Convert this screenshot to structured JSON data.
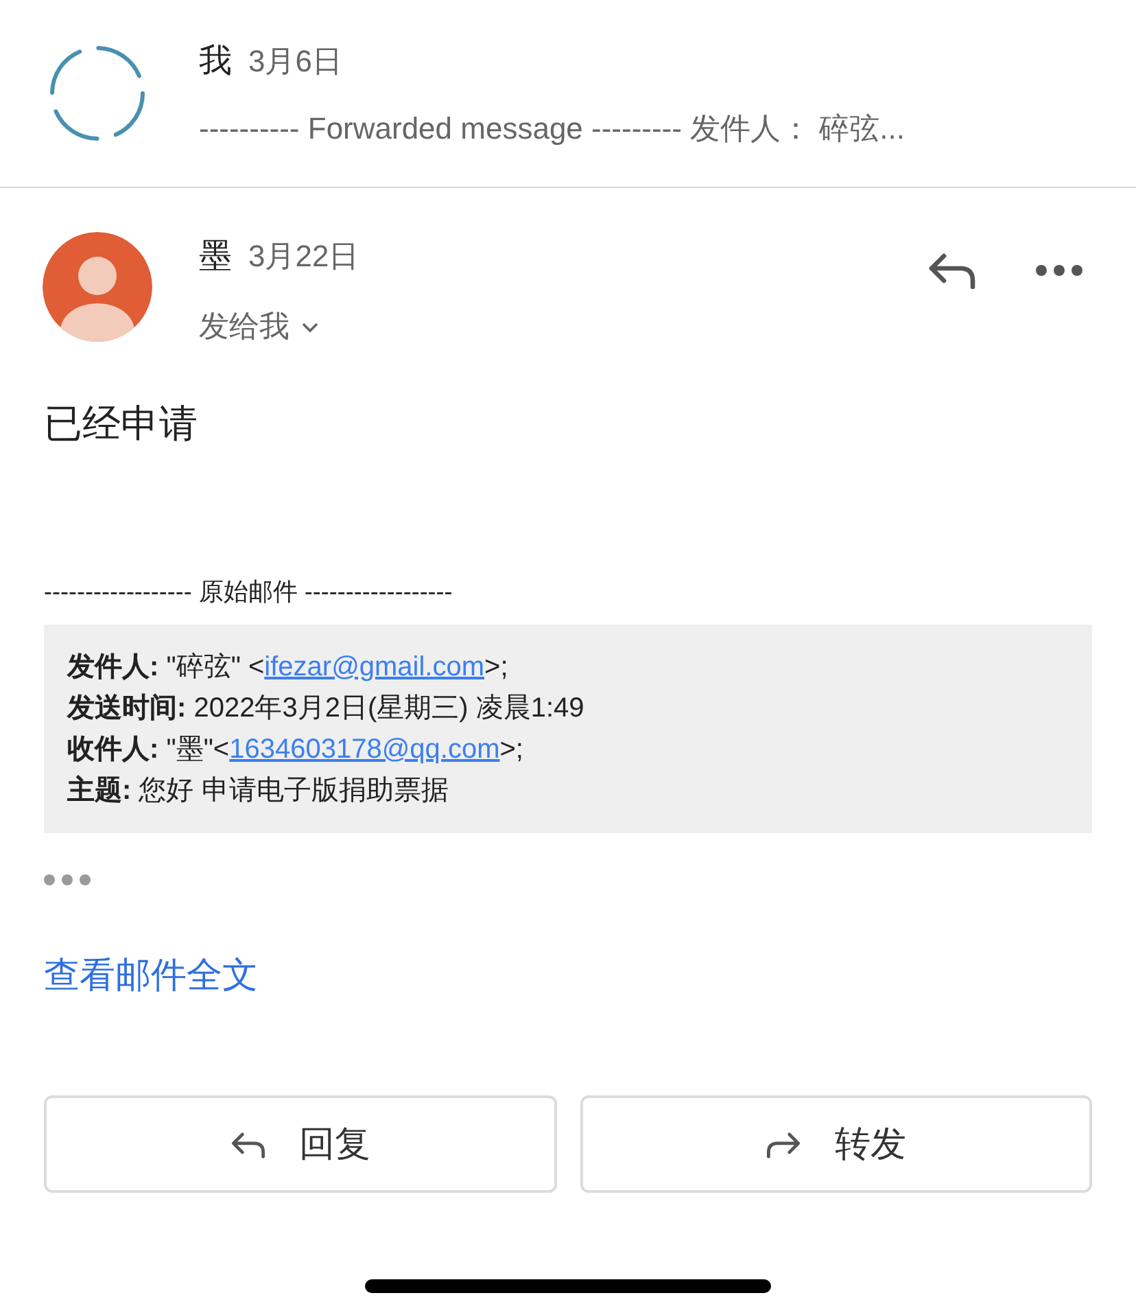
{
  "thread": [
    {
      "kind": "loading",
      "sender": "我",
      "date": "3月6日",
      "preview": "---------- Forwarded message --------- 发件人：  碎弦..."
    }
  ],
  "message": {
    "sender": "墨",
    "date": "3月22日",
    "recipient_toggle": "发给我",
    "expanded": false,
    "body": "已经申请",
    "separator": "------------------ 原始邮件 ------------------",
    "original_headers": [
      {
        "prefix": "**发件人:** \"碎弦\" <",
        "link": "ifezar@gmail.com",
        "suffix": ">;"
      },
      {
        "prefix": "**发送时间:** 2022年3月2日(星期三) 凌晨1:49"
      },
      {
        "prefix": "**收件人:** \"墨\"<",
        "link": "1634603178@qq.com",
        "suffix": ">;"
      },
      {
        "prefix": "**主题:** 您好 申请电子版捐助票据"
      }
    ],
    "view_full": "查看邮件全文"
  },
  "buttons": [
    {
      "kind": "reply",
      "label": "回复"
    },
    {
      "kind": "forward",
      "label": "转发"
    }
  ]
}
